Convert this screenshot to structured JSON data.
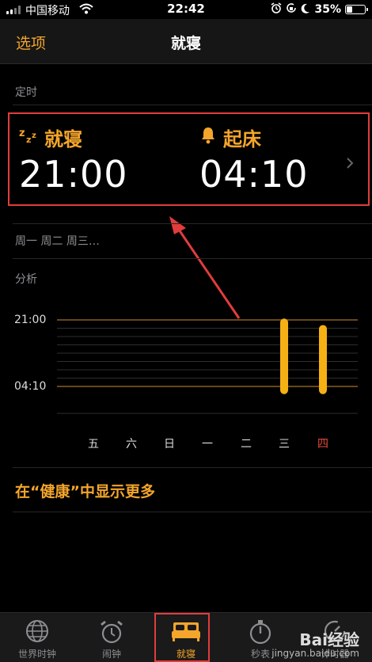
{
  "status": {
    "carrier": "中国移动",
    "time": "22:42",
    "battery": "35%",
    "battery_level": 0.35
  },
  "nav": {
    "left": "选项",
    "title": "就寝"
  },
  "schedule": {
    "section_label": "定时",
    "bedtime_label": "就寝",
    "bedtime": "21:00",
    "wake_label": "起床",
    "wake": "04:10"
  },
  "repeat_days": "周一 周二 周三…",
  "analysis": {
    "section_label": "分析"
  },
  "chart_data": {
    "type": "bar",
    "categories": [
      "五",
      "六",
      "日",
      "一",
      "二",
      "三",
      "四"
    ],
    "y_ticks": [
      "21:00",
      "04:10"
    ],
    "series": [
      {
        "values": [
          null,
          null,
          null,
          null,
          null,
          [
            20.85,
            29.0
          ],
          [
            21.55,
            29.0
          ]
        ]
      }
    ],
    "ylim": [
      21.0,
      28.1667
    ],
    "highlight_category": "四",
    "colors": {
      "bar": "#f5b014",
      "grid": "#a87424",
      "today": "#e84c3d"
    }
  },
  "health_link": "在“健康”中显示更多",
  "tabs": [
    {
      "label": "世界时钟",
      "icon": "globe-icon"
    },
    {
      "label": "闹钟",
      "icon": "alarm-clock-icon"
    },
    {
      "label": "就寝",
      "icon": "bed-icon",
      "active": true
    },
    {
      "label": "秒表",
      "icon": "stopwatch-icon"
    },
    {
      "label": "计时器",
      "icon": "timer-icon"
    }
  ],
  "watermark": {
    "brand": "Bai经验",
    "url": "jingyan.baidu.com"
  }
}
